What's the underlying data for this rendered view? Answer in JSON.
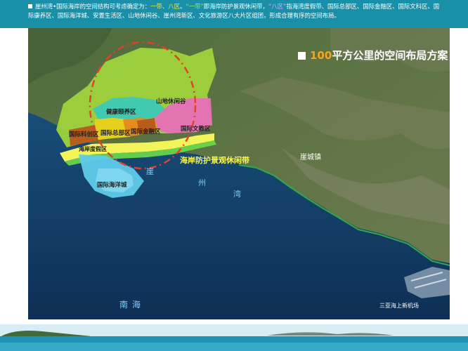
{
  "header": {
    "text_parts": [
      {
        "text": "崖州湾•国际海岸的空间结构可考虑确定为：",
        "tone": "white"
      },
      {
        "text": "一带、八区",
        "tone": "yellow"
      },
      {
        "text": "。",
        "tone": "white"
      },
      {
        "text": "“一带”",
        "tone": "green"
      },
      {
        "text": "即海岸防护景观休闲带，",
        "tone": "white"
      },
      {
        "text": "“八区”",
        "tone": "purple"
      },
      {
        "text": "指海湾度假带、国际总部区、国际金融区、国际文科区、国际康养区、国际海洋城、安置生活区、山地休闲谷、崖州湾新区、文化旅游区八大片区组团，形成合理有序的空间布局。",
        "tone": "white"
      }
    ]
  },
  "map": {
    "title_number": "100",
    "title_rest": "平方公里的空间布局方案",
    "zones": {
      "mountain": "山地休闲谷",
      "health": "健康颐养区",
      "hq": "国际总部区",
      "finance": "国际金融区",
      "tech": "国际科创区",
      "culture": "国际文教区",
      "resort": "海岸度假区",
      "ocean_city": "国际海洋城"
    },
    "band_label": "海岸防护景观休闲带",
    "town_label": "崖城镇",
    "bay_chars": [
      "崖",
      "州",
      "湾"
    ],
    "sea_label": "南海",
    "airport_label": "三亚海上新机场"
  },
  "colors": {
    "header_bg": "#1a8fa8",
    "zone_green": "#a2d63c",
    "zone_teal": "#3cc9b5",
    "zone_orange": "#e58a1e",
    "zone_yellow": "#e8cf1d",
    "zone_brown": "#b5581c",
    "zone_pink": "#e76fb7",
    "ocean_city": "#5fcbea",
    "coast_band": "#f3f35a",
    "circle": "#e3402f"
  }
}
